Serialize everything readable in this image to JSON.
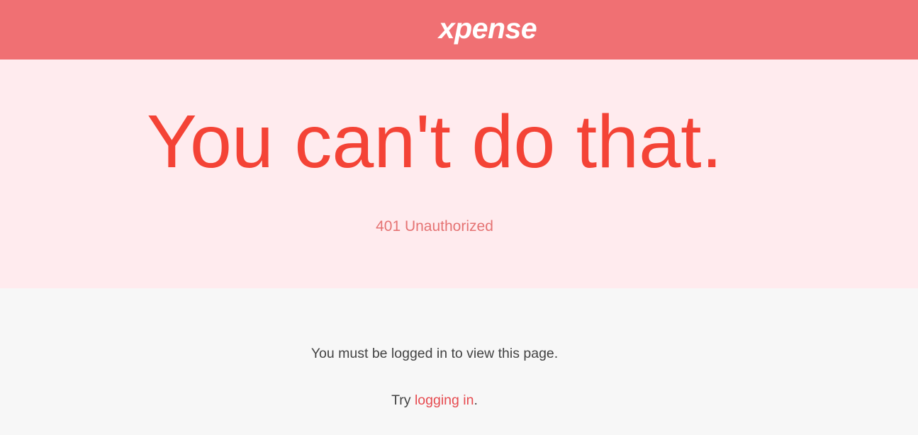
{
  "header": {
    "logo_text": "xpense"
  },
  "hero": {
    "headline": "You can't do that.",
    "status": "401 Unauthorized"
  },
  "main": {
    "message": "You must be logged in to view this page.",
    "try_prefix": "Try ",
    "login_link_label": "logging in",
    "try_suffix": "."
  },
  "colors": {
    "header_bg": "#f07073",
    "hero_bg": "#ffebee",
    "headline": "#f44336",
    "status": "#e57373",
    "link": "#e64a4f",
    "page_bg": "#f7f7f7"
  }
}
